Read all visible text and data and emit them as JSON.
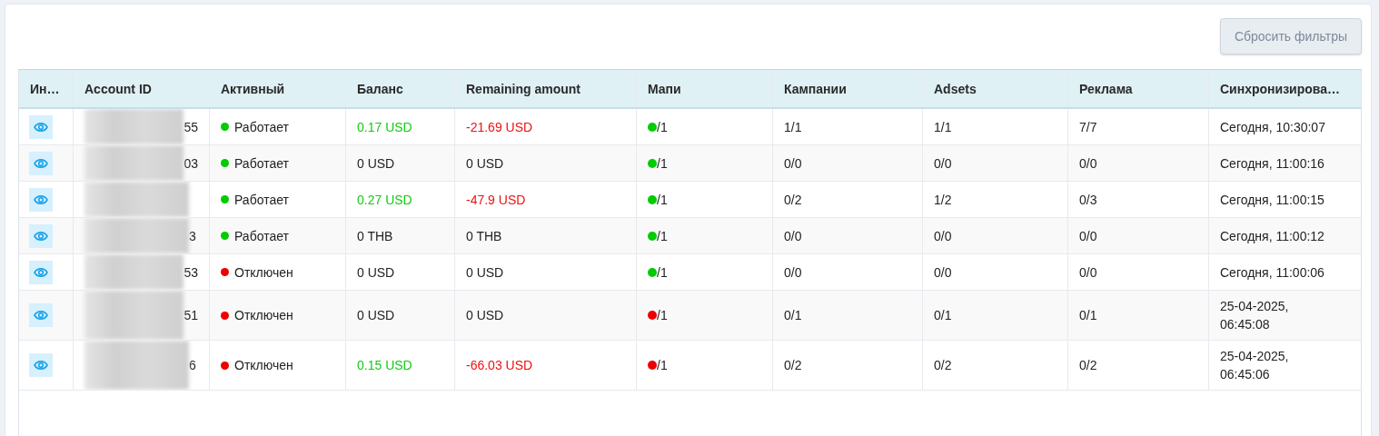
{
  "reset_button": "Сбросить фильтры",
  "table": {
    "columns": [
      "Ин…",
      "Account ID",
      "Активный",
      "Баланс",
      "Remaining amount",
      "Мапи",
      "Кампании",
      "Adsets",
      "Реклама",
      "Синхронизирова…"
    ],
    "rows": [
      {
        "id_end": "55",
        "status": {
          "text": "Работает",
          "color": "#00cc00"
        },
        "balance": {
          "text": "0.17 USD",
          "color": "#11cc11"
        },
        "remaining": {
          "text": "-21.69 USD",
          "color": "#ee1111"
        },
        "mapi": {
          "text": "/1",
          "color": "#00cc00"
        },
        "campaigns": "1/1",
        "adsets": "1/1",
        "ads": "7/7",
        "sync": [
          "Сегодня, 10:30:07"
        ]
      },
      {
        "id_end": "03",
        "status": {
          "text": "Работает",
          "color": "#00cc00"
        },
        "balance": {
          "text": "0 USD",
          "color": "#222222"
        },
        "remaining": {
          "text": "0 USD",
          "color": "#222222"
        },
        "mapi": {
          "text": "/1",
          "color": "#00cc00"
        },
        "campaigns": "0/0",
        "adsets": "0/0",
        "ads": "0/0",
        "sync": [
          "Сегодня, 11:00:16"
        ]
      },
      {
        "status": {
          "text": "Работает",
          "color": "#00cc00"
        },
        "balance": {
          "text": "0.27 USD",
          "color": "#11cc11"
        },
        "remaining": {
          "text": "-47.9 USD",
          "color": "#ee1111"
        },
        "mapi": {
          "text": "/1",
          "color": "#00cc00"
        },
        "campaigns": "0/2",
        "adsets": "1/2",
        "ads": "0/3",
        "sync": [
          "Сегодня, 11:00:15"
        ]
      },
      {
        "id_end": "3",
        "status": {
          "text": "Работает",
          "color": "#00cc00"
        },
        "balance": {
          "text": "0 THB",
          "color": "#222222"
        },
        "remaining": {
          "text": "0 THB",
          "color": "#222222"
        },
        "mapi": {
          "text": "/1",
          "color": "#00cc00"
        },
        "campaigns": "0/0",
        "adsets": "0/0",
        "ads": "0/0",
        "sync": [
          "Сегодня, 11:00:12"
        ]
      },
      {
        "id_end": "53",
        "status": {
          "text": "Отключен",
          "color": "#ee0000"
        },
        "balance": {
          "text": "0 USD",
          "color": "#222222"
        },
        "remaining": {
          "text": "0 USD",
          "color": "#222222"
        },
        "mapi": {
          "text": "/1",
          "color": "#00cc00"
        },
        "campaigns": "0/0",
        "adsets": "0/0",
        "ads": "0/0",
        "sync": [
          "Сегодня, 11:00:06"
        ]
      },
      {
        "id_end": "51",
        "status": {
          "text": "Отключен",
          "color": "#ee0000"
        },
        "balance": {
          "text": "0 USD",
          "color": "#222222"
        },
        "remaining": {
          "text": "0 USD",
          "color": "#222222"
        },
        "mapi": {
          "text": "/1",
          "color": "#ee0000"
        },
        "campaigns": "0/1",
        "adsets": "0/1",
        "ads": "0/1",
        "sync": [
          "25-04-2025,",
          "06:45:08"
        ]
      },
      {
        "id_end": "6",
        "status": {
          "text": "Отключен",
          "color": "#ee0000"
        },
        "balance": {
          "text": "0.15 USD",
          "color": "#11cc11"
        },
        "remaining": {
          "text": "-66.03 USD",
          "color": "#ee1111"
        },
        "mapi": {
          "text": "/1",
          "color": "#ee0000"
        },
        "campaigns": "0/2",
        "adsets": "0/2",
        "ads": "0/2",
        "sync": [
          "25-04-2025,",
          "06:45:06"
        ]
      }
    ]
  }
}
